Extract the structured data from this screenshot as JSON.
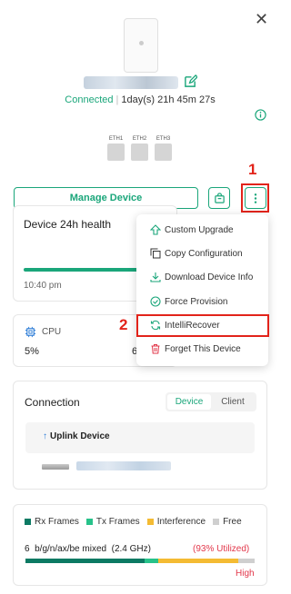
{
  "header": {
    "status": "Connected",
    "uptime": "1day(s) 21h 45m 27s"
  },
  "ports": [
    "ETH1",
    "ETH2",
    "ETH3"
  ],
  "actions": {
    "manage_label": "Manage Device"
  },
  "annotations": {
    "mark1": "1",
    "mark2": "2"
  },
  "menu": {
    "items": [
      {
        "label": "Custom Upgrade",
        "icon": "upgrade-icon"
      },
      {
        "label": "Copy Configuration",
        "icon": "copy-icon"
      },
      {
        "label": "Download Device Info",
        "icon": "download-icon"
      },
      {
        "label": "Force Provision",
        "icon": "check-circle-icon"
      },
      {
        "label": "IntelliRecover",
        "icon": "refresh-icon"
      },
      {
        "label": "Forget This Device",
        "icon": "trash-icon"
      }
    ]
  },
  "health": {
    "title": "Device 24h health",
    "time": "10:40 pm"
  },
  "cpu": {
    "label": "CPU",
    "value": "5%",
    "value2": "6"
  },
  "connection": {
    "title": "Connection",
    "tabs": [
      "Device",
      "Client"
    ],
    "active_tab": "Device",
    "uplink_title": "Uplink Device"
  },
  "radio": {
    "legend": [
      {
        "label": "Rx Frames",
        "color": "#0c7a63"
      },
      {
        "label": "Tx Frames",
        "color": "#27c28a"
      },
      {
        "label": "Interference",
        "color": "#f4bb33"
      },
      {
        "label": "Free",
        "color": "#cfcfcf"
      }
    ],
    "band": "6",
    "mode": "b/g/n/ax/be mixed",
    "freq": "(2.4 GHz)",
    "utilization": "(93% Utilized)",
    "level": "High",
    "segments": [
      52,
      6,
      35,
      7
    ]
  },
  "colors": {
    "accent": "#1aa67a",
    "annotation": "#e2231a",
    "warning": "#e2374a"
  }
}
